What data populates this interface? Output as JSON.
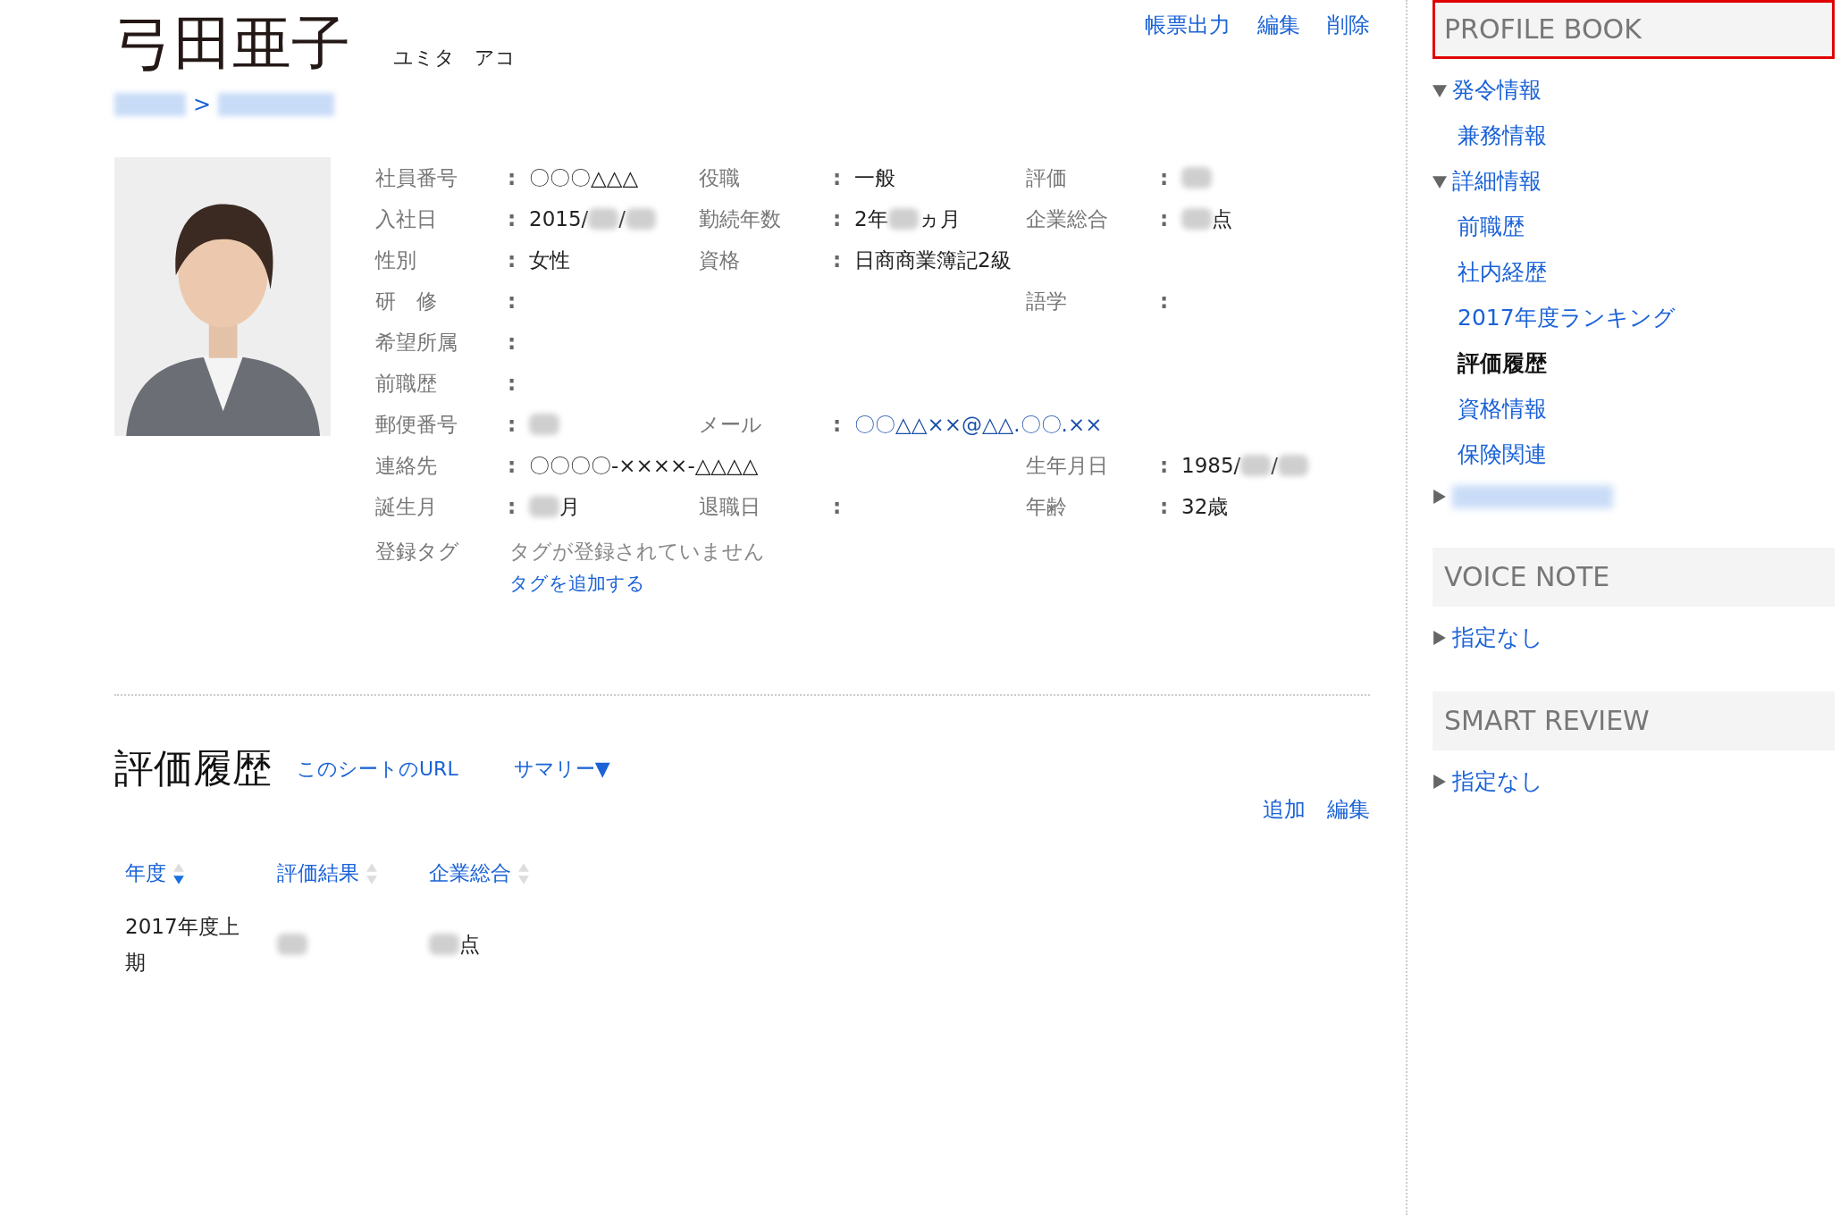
{
  "profile": {
    "name": "弓田亜子",
    "kana": "ユミタ　アコ",
    "actions": [
      "帳票出力",
      "編集",
      "削除"
    ],
    "breadcrumb": [
      {
        "kind": "redacted"
      },
      {
        "kind": "separator",
        "text": ">"
      },
      {
        "kind": "redacted"
      }
    ],
    "photo": {
      "kind": "picture"
    }
  },
  "fields": [
    [
      {
        "label": "社員番号",
        "value": [
          {
            "kind": "text",
            "text": "〇〇〇△△△"
          }
        ]
      },
      {
        "label": "役職",
        "value": [
          {
            "kind": "text",
            "text": "一般"
          }
        ]
      },
      {
        "label": "評価",
        "value": [
          {
            "kind": "redacted"
          }
        ]
      }
    ],
    [
      {
        "label": "入社日",
        "value": [
          {
            "kind": "text",
            "text": "2015/"
          },
          {
            "kind": "redacted"
          },
          {
            "kind": "text",
            "text": "/"
          },
          {
            "kind": "redacted"
          }
        ]
      },
      {
        "label": "勤続年数",
        "value": [
          {
            "kind": "text",
            "text": "2年"
          },
          {
            "kind": "redacted"
          },
          {
            "kind": "text",
            "text": "ヵ月"
          }
        ]
      },
      {
        "label": "企業総合",
        "value": [
          {
            "kind": "redacted"
          },
          {
            "kind": "text",
            "text": "点"
          }
        ]
      }
    ],
    [
      {
        "label": "性別",
        "value": [
          {
            "kind": "text",
            "text": "女性"
          }
        ]
      },
      {
        "label": "資格",
        "value": [
          {
            "kind": "text",
            "text": "日商商業簿記2級"
          }
        ]
      },
      {
        "kind": "empty"
      }
    ],
    [
      {
        "label": "研　修"
      },
      {
        "kind": "empty"
      },
      {
        "label": "語学"
      }
    ],
    [
      {
        "label": "希望所属"
      },
      {
        "kind": "empty"
      },
      {
        "kind": "empty"
      }
    ],
    [
      {
        "label": "前職歴"
      },
      {
        "kind": "empty"
      },
      {
        "kind": "empty"
      }
    ],
    [
      {
        "label": "郵便番号",
        "value": [
          {
            "kind": "redacted"
          }
        ]
      },
      {
        "label": "メール",
        "value": [
          {
            "kind": "link",
            "text": "〇〇△△××@△△.〇〇.××"
          }
        ]
      },
      {
        "kind": "empty"
      }
    ],
    [
      {
        "label": "連絡先",
        "value": [
          {
            "kind": "text",
            "text": "〇〇〇〇-××××-△△△△"
          }
        ]
      },
      {
        "kind": "empty"
      },
      {
        "label": "生年月日",
        "value": [
          {
            "kind": "text",
            "text": "1985/"
          },
          {
            "kind": "redacted"
          },
          {
            "kind": "text",
            "text": "/"
          },
          {
            "kind": "redacted"
          }
        ]
      }
    ],
    [
      {
        "label": "誕生月",
        "value": [
          {
            "kind": "redacted"
          },
          {
            "kind": "text",
            "text": "月"
          }
        ]
      },
      {
        "label": "退職日"
      },
      {
        "label": "年齢",
        "value": [
          {
            "kind": "text",
            "text": "32歳"
          }
        ]
      }
    ]
  ],
  "separator": ":",
  "tags": {
    "label": "登録タグ",
    "empty_text": "タグが登録されていません",
    "add_link": "タグを追加する"
  },
  "history": {
    "title": "評価履歴",
    "url_link": "このシートのURL",
    "summary": {
      "label": "サマリー",
      "marker": "▼"
    },
    "actions": [
      "追加",
      "編集"
    ],
    "columns": [
      {
        "label": "年度",
        "sorted": true
      },
      {
        "label": "評価結果",
        "sorted": false
      },
      {
        "label": "企業総合",
        "sorted": false
      }
    ],
    "rows": [
      [
        [
          {
            "kind": "text",
            "text": "2017年度上期"
          }
        ],
        [
          {
            "kind": "redacted"
          }
        ],
        [
          {
            "kind": "redacted"
          },
          {
            "kind": "text",
            "text": "点"
          }
        ]
      ]
    ]
  },
  "sidebar": [
    {
      "title": "PROFILE BOOK",
      "highlighted": true,
      "items": [
        {
          "kind": "group",
          "label": "発令情報",
          "expanded": true,
          "children": [
            {
              "label": "兼務情報",
              "selected": false
            }
          ]
        },
        {
          "kind": "group",
          "label": "詳細情報",
          "expanded": true,
          "children": [
            {
              "label": "前職歴",
              "selected": false
            },
            {
              "label": "社内経歴",
              "selected": false
            },
            {
              "label": "2017年度ランキング",
              "selected": false
            },
            {
              "label": "評価履歴",
              "selected": true
            },
            {
              "label": "資格情報",
              "selected": false
            },
            {
              "label": "保険関連",
              "selected": false
            }
          ]
        },
        {
          "kind": "redacted",
          "expanded": false
        }
      ]
    },
    {
      "title": "VOICE NOTE",
      "highlighted": false,
      "items": [
        {
          "kind": "group",
          "label": "指定なし",
          "expanded": false
        }
      ]
    },
    {
      "title": "SMART REVIEW",
      "highlighted": false,
      "items": [
        {
          "kind": "group",
          "label": "指定なし",
          "expanded": false
        }
      ]
    }
  ]
}
